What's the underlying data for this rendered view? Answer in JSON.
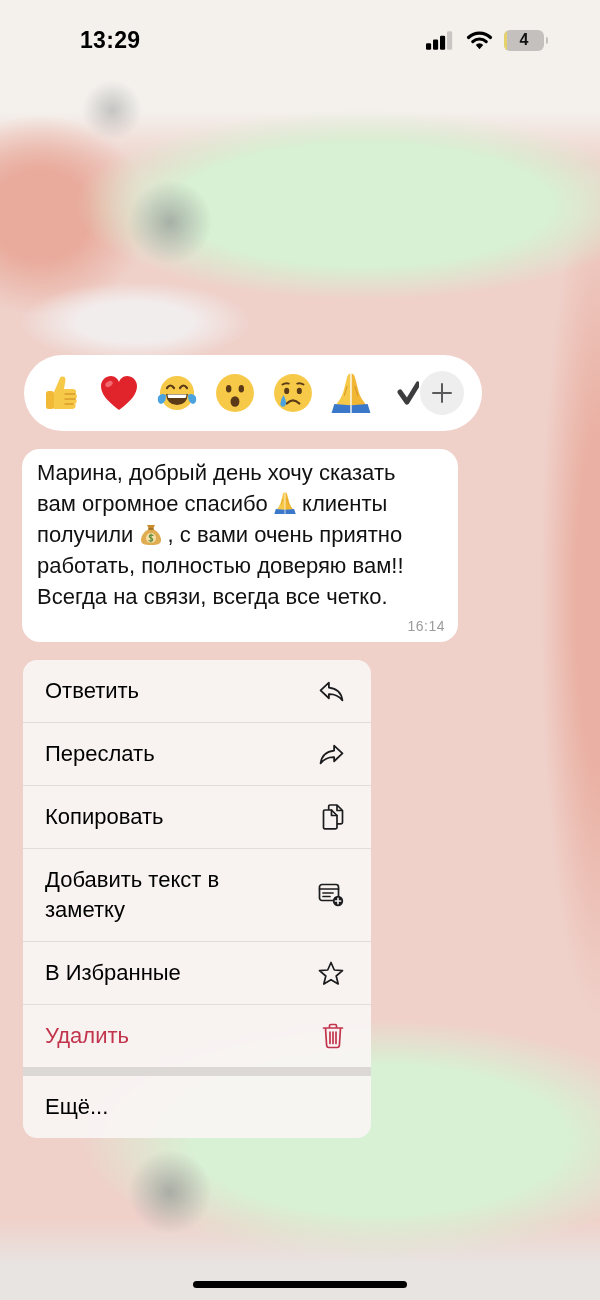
{
  "status_bar": {
    "time": "13:29",
    "battery": "4"
  },
  "reactions": [
    {
      "kind": "thumbs_up"
    },
    {
      "kind": "heart"
    },
    {
      "kind": "tears_of_joy"
    },
    {
      "kind": "surprised"
    },
    {
      "kind": "crying"
    },
    {
      "kind": "folded_hands"
    },
    {
      "kind": "check_mark"
    },
    {
      "kind": "add"
    }
  ],
  "message": {
    "parts": [
      {
        "kind": "text",
        "text": "Марина, добрый день хочу сказать вам огромное спасибо "
      },
      {
        "kind": "folded_hands"
      },
      {
        "kind": "text",
        "text": " клиенты получили "
      },
      {
        "kind": "money_bag"
      },
      {
        "kind": "text",
        "text": " , с вами очень приятно работать, полностью доверяю вам!! Всегда на связи, всегда все четко."
      }
    ],
    "time": "16:14"
  },
  "menu": {
    "sections": [
      {
        "items": [
          {
            "kind": "reply",
            "label": "Ответить",
            "destructive": false
          },
          {
            "kind": "forward",
            "label": "Переслать",
            "destructive": false
          },
          {
            "kind": "copy",
            "label": "Копировать",
            "destructive": false
          },
          {
            "kind": "note",
            "label": "Добавить текст в заметку",
            "destructive": false
          },
          {
            "kind": "favorite",
            "label": "В Избранные",
            "destructive": false
          },
          {
            "kind": "delete",
            "label": "Удалить",
            "destructive": true
          }
        ]
      },
      {
        "items": [
          {
            "kind": "more",
            "label": "Ещё...",
            "destructive": false
          }
        ]
      }
    ]
  }
}
